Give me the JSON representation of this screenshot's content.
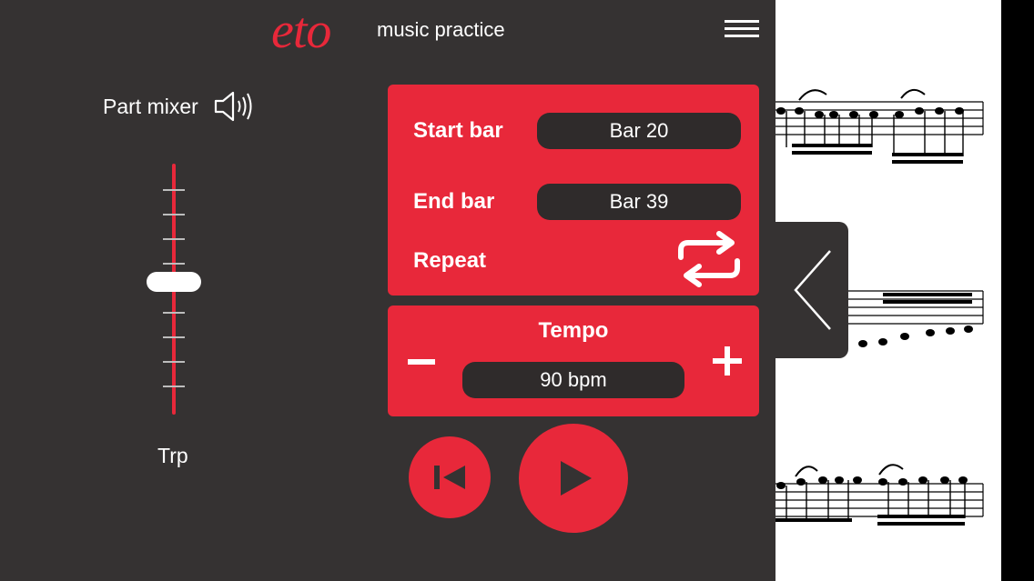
{
  "header": {
    "logo": "eto",
    "subtitle": "music practice",
    "menu_icon": "hamburger-menu-icon"
  },
  "mixer": {
    "title": "Part mixer",
    "speaker_icon": "speaker-volume-icon",
    "part_label": "Trp",
    "volume_level": 0.53
  },
  "range": {
    "start_label": "Start bar",
    "start_value": "Bar 20",
    "end_label": "End bar",
    "end_value": "Bar 39",
    "repeat_label": "Repeat",
    "repeat_icon": "repeat-loop-icon"
  },
  "tempo": {
    "title": "Tempo",
    "value": "90 bpm",
    "minus_icon": "minus-icon",
    "plus_icon": "plus-icon"
  },
  "transport": {
    "rewind_icon": "skip-to-start-icon",
    "play_icon": "play-icon"
  },
  "score": {
    "toggle_icon": "chevron-left-icon"
  },
  "colors": {
    "accent": "#e8283a",
    "panel": "#353232",
    "pill": "#2f2b2b",
    "paper": "#ffffff"
  }
}
